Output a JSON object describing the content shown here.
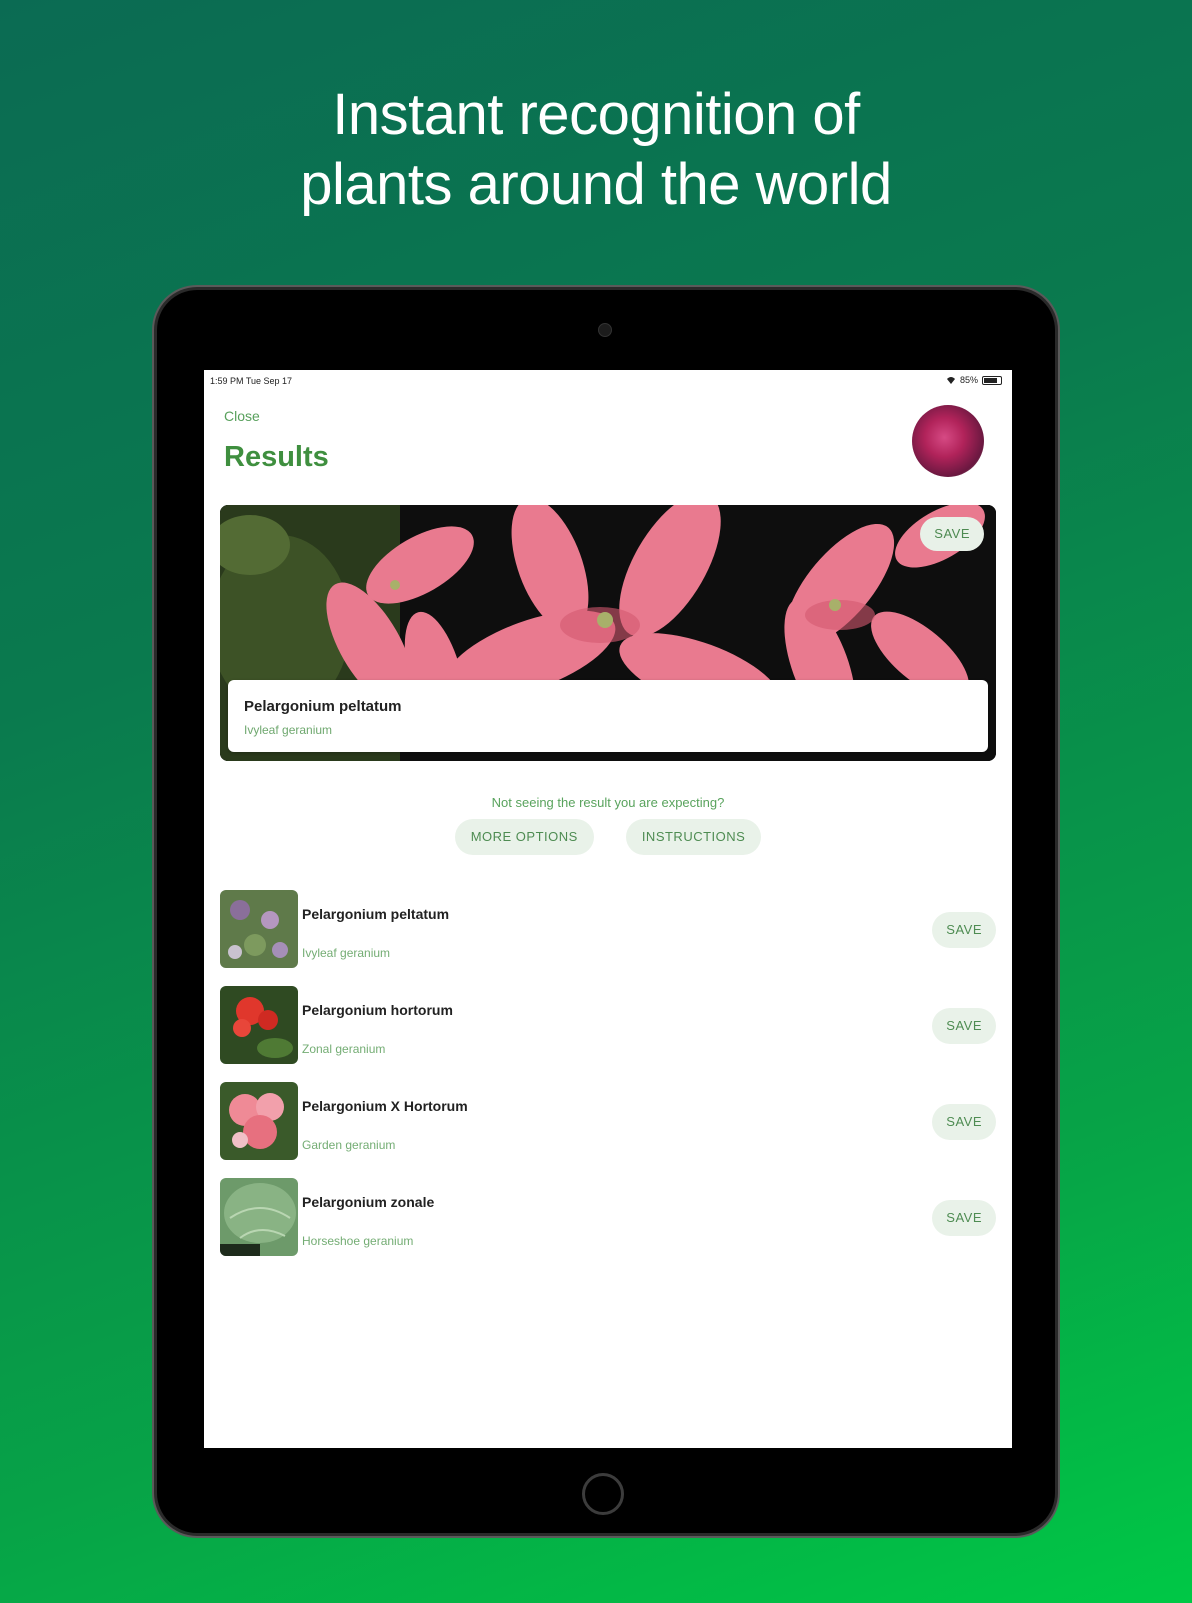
{
  "headline": {
    "line1": "Instant recognition of",
    "line2": "plants around the world"
  },
  "status_bar": {
    "time": "1:59 PM  Tue Sep 17",
    "battery": "85%"
  },
  "nav": {
    "close_label": "Close",
    "title": "Results"
  },
  "top_result": {
    "save_label": "SAVE",
    "name": "Pelargonium peltatum",
    "common_name": "Ivyleaf geranium"
  },
  "help": {
    "prompt": "Not seeing the result you are expecting?",
    "more_options_label": "MORE OPTIONS",
    "instructions_label": "INSTRUCTIONS"
  },
  "results": [
    {
      "name": "Pelargonium peltatum",
      "common_name": "Ivyleaf geranium",
      "save_label": "SAVE"
    },
    {
      "name": "Pelargonium hortorum",
      "common_name": "Zonal geranium",
      "save_label": "SAVE"
    },
    {
      "name": "Pelargonium X Hortorum",
      "common_name": "Garden geranium",
      "save_label": "SAVE"
    },
    {
      "name": "Pelargonium zonale",
      "common_name": "Horseshoe geranium",
      "save_label": "SAVE"
    }
  ],
  "colors": {
    "accent_green": "#3f8f3f",
    "light_green_bg": "#e9f2e9",
    "gradient_start": "#0b6b53",
    "gradient_end": "#00c846"
  }
}
